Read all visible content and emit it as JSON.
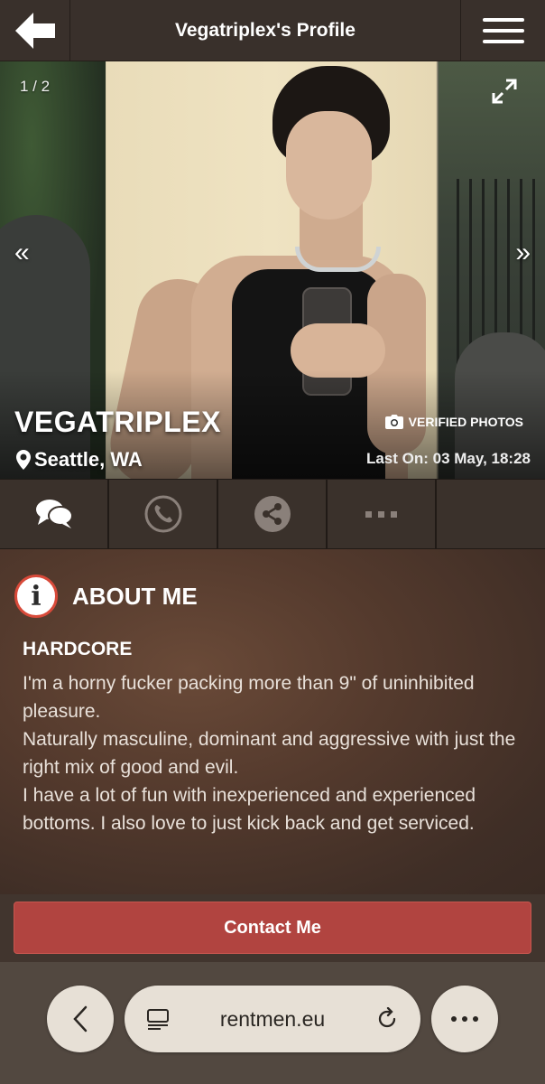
{
  "header": {
    "title": "Vegatriplex's Profile",
    "back_icon": "arrow-left-icon",
    "menu_icon": "hamburger-menu-icon"
  },
  "photo": {
    "counter": "1 / 2",
    "prev": "«",
    "next": "»",
    "username": "VEGATRIPLEX",
    "location": "Seattle, WA",
    "verified": "VERIFIED PHOTOS",
    "last_on": "Last On: 03 May, 18:28"
  },
  "actions": [
    {
      "name": "chat",
      "icon": "chat-bubbles-icon"
    },
    {
      "name": "call",
      "icon": "phone-icon"
    },
    {
      "name": "share",
      "icon": "share-icon"
    },
    {
      "name": "more",
      "icon": "more-dots-icon"
    }
  ],
  "about": {
    "title": "ABOUT ME",
    "subtitle": "HARDCORE",
    "body": "I'm a horny fucker packing more than 9\" of uninhibited pleasure.\nNaturally masculine, dominant and aggressive with just the right mix of good and evil.\nI have a lot of fun with inexperienced and experienced bottoms. I also love to just kick back and get serviced."
  },
  "contact": {
    "label": "Contact Me"
  },
  "browser": {
    "url": "rentmen.eu"
  },
  "colors": {
    "accent": "#b14440",
    "header_bg": "#39302b",
    "info_ring": "#d84a3a"
  }
}
